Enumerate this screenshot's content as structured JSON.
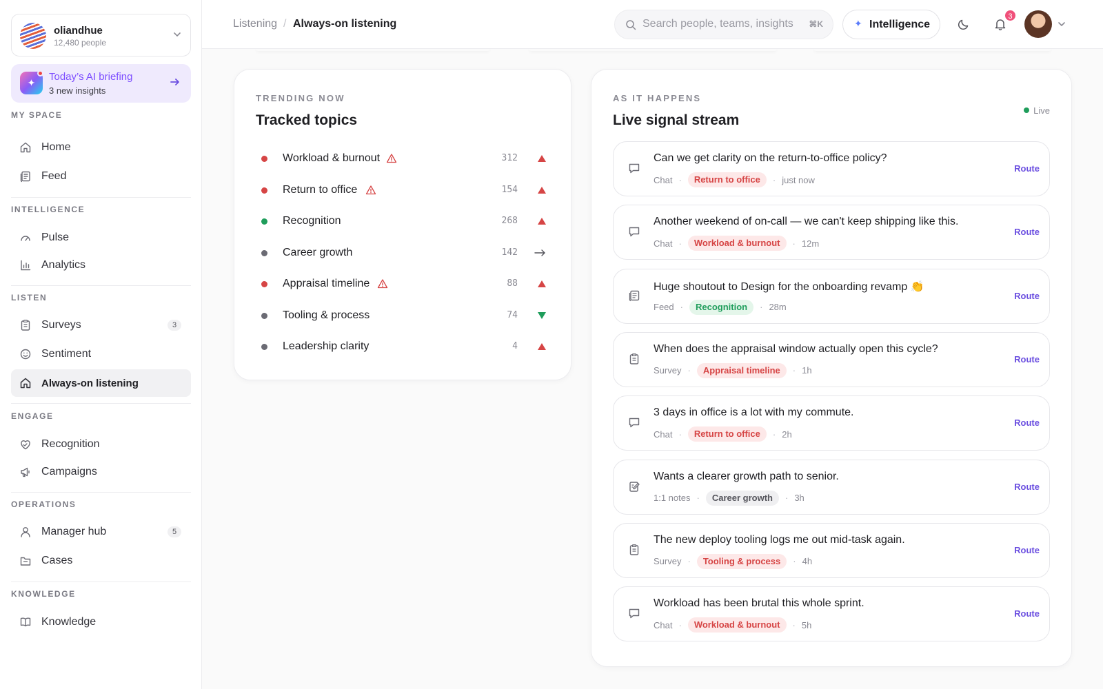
{
  "org": {
    "name": "oliandhue",
    "people": "12,480 people"
  },
  "briefing": {
    "title": "Today’s AI briefing",
    "subtitle": "3 new insights"
  },
  "sidebar": {
    "sections": {
      "my_space": "MY SPACE",
      "intelligence": "INTELLIGENCE",
      "listen": "LISTEN",
      "engage": "ENGAGE",
      "operations": "OPERATIONS",
      "knowledge": "KNOWLEDGE"
    },
    "items": {
      "home": "Home",
      "feed": "Feed",
      "pulse": "Pulse",
      "analytics": "Analytics",
      "surveys": "Surveys",
      "surveys_badge": "3",
      "sentiment": "Sentiment",
      "always_on": "Always-on listening",
      "recognition": "Recognition",
      "campaigns": "Campaigns",
      "manager_hub": "Manager hub",
      "manager_hub_badge": "5",
      "cases": "Cases",
      "knowledge": "Knowledge"
    }
  },
  "header": {
    "breadcrumb": [
      "Listening",
      "/",
      "Always-on listening"
    ],
    "search_placeholder": "Search people, teams, insights",
    "search_shortcut": "⌘K",
    "intelligence_label": "Intelligence",
    "notifications_count": "3"
  },
  "topics": {
    "eyebrow": "TRENDING NOW",
    "title": "Tracked topics",
    "items": [
      {
        "name": "Workload & burnout",
        "count": "312",
        "trend": "up",
        "status": "#d64545",
        "alert": true
      },
      {
        "name": "Return to office",
        "count": "154",
        "trend": "up",
        "status": "#d64545",
        "alert": true
      },
      {
        "name": "Recognition",
        "count": "268",
        "trend": "up",
        "status": "#1f9d5b",
        "alert": false
      },
      {
        "name": "Career growth",
        "count": "142",
        "trend": "flat",
        "status": "#6b6b74",
        "alert": false
      },
      {
        "name": "Appraisal timeline",
        "count": "88",
        "trend": "up",
        "status": "#d64545",
        "alert": true
      },
      {
        "name": "Tooling & process",
        "count": "74",
        "trend": "down",
        "status": "#6b6b74",
        "alert": false
      },
      {
        "name": "Leadership clarity",
        "count": "4",
        "trend": "up",
        "status": "#6b6b74",
        "alert": false
      }
    ]
  },
  "stream": {
    "eyebrow": "AS IT HAPPENS",
    "title": "Live signal stream",
    "live_label": "Live",
    "route_label": "Route",
    "items": [
      {
        "text": "Can we get clarity on the return-to-office policy?",
        "source": "Chat",
        "tag": "Return to office",
        "tag_color": "red",
        "time": "just now",
        "icon": "chat-icon"
      },
      {
        "text": "Another weekend of on-call — we can't keep shipping like this.",
        "source": "Chat",
        "tag": "Workload & burnout",
        "tag_color": "red",
        "time": "12m",
        "icon": "chat-icon"
      },
      {
        "text": "Huge shoutout to Design for the onboarding revamp 👏",
        "source": "Feed",
        "tag": "Recognition",
        "tag_color": "green",
        "time": "28m",
        "icon": "feed-icon"
      },
      {
        "text": "When does the appraisal window actually open this cycle?",
        "source": "Survey",
        "tag": "Appraisal timeline",
        "tag_color": "red",
        "time": "1h",
        "icon": "survey-icon"
      },
      {
        "text": "3 days in office is a lot with my commute.",
        "source": "Chat",
        "tag": "Return to office",
        "tag_color": "red",
        "time": "2h",
        "icon": "chat-icon"
      },
      {
        "text": "Wants a clearer growth path to senior.",
        "source": "1:1 notes",
        "tag": "Career growth",
        "tag_color": "gray",
        "time": "3h",
        "icon": "notes-icon"
      },
      {
        "text": "The new deploy tooling logs me out mid-task again.",
        "source": "Survey",
        "tag": "Tooling & process",
        "tag_color": "red",
        "time": "4h",
        "icon": "survey-icon"
      },
      {
        "text": "Workload has been brutal this whole sprint.",
        "source": "Chat",
        "tag": "Workload & burnout",
        "tag_color": "red",
        "time": "5h",
        "icon": "chat-icon"
      }
    ]
  }
}
